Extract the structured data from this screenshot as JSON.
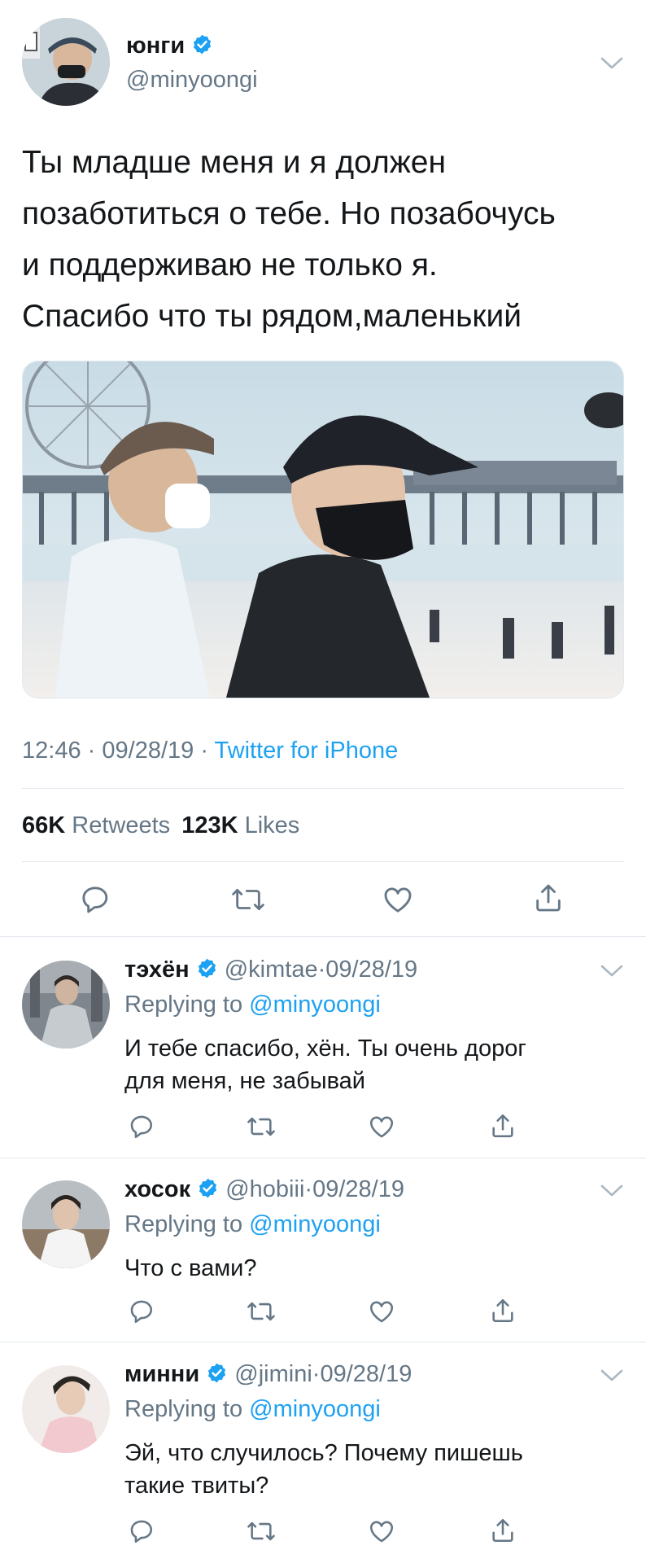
{
  "main_tweet": {
    "display_name": "юнги",
    "handle": "@minyoongi",
    "text_lines": [
      "Ты младше меня и я должен",
      "позаботиться о тебе. Но позабочусь",
      "и поддерживаю не только я.",
      "Спасибо что ты рядом,маленький"
    ],
    "time": "12:46",
    "date": "09/28/19",
    "source": "Twitter for iPhone",
    "sep": "·",
    "retweets_count": "66K",
    "retweets_label": "Retweets",
    "likes_count": "123K",
    "likes_label": "Likes"
  },
  "replies": [
    {
      "display_name": "тэхён",
      "handle": "@kimtae",
      "date": "09/28/19",
      "replying_label": "Replying to",
      "replying_handle": "@minyoongi",
      "text_lines": [
        "И тебе спасибо, хён. Ты очень дорог",
        "для меня, не забывай"
      ]
    },
    {
      "display_name": "хосок",
      "handle": "@hobiii",
      "date": "09/28/19",
      "replying_label": "Replying to",
      "replying_handle": "@minyoongi",
      "text_lines": [
        "Что с вами?"
      ]
    },
    {
      "display_name": "минни",
      "handle": "@jimini",
      "date": "09/28/19",
      "replying_label": "Replying to",
      "replying_handle": "@minyoongi",
      "text_lines": [
        "Эй, что случилось? Почему пишешь",
        "такие твиты?"
      ]
    }
  ],
  "colors": {
    "accent": "#1da1f2",
    "muted": "#657786",
    "text": "#14171a",
    "divider": "#e1e8ed"
  },
  "icons": {
    "reply": "speech-bubble-icon",
    "retweet": "retweet-icon",
    "like": "heart-icon",
    "share": "share-icon",
    "verified": "verified-badge-icon",
    "menu": "chevron-down-icon"
  }
}
